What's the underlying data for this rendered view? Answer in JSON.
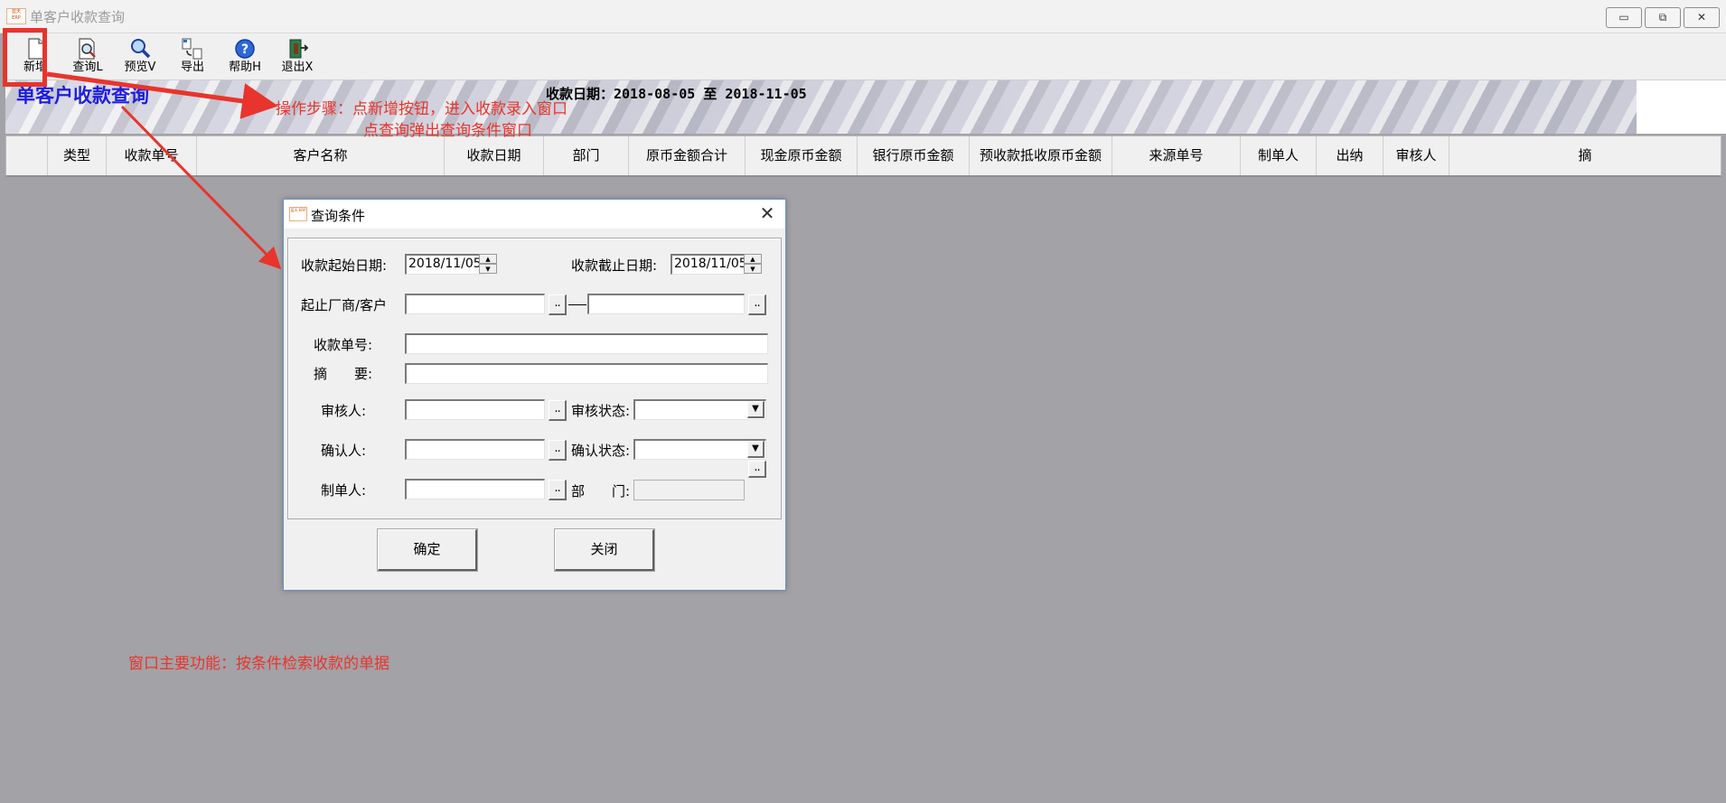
{
  "window": {
    "title": "单客户收款查询",
    "icon_text": "蓝天 ERP",
    "controls": [
      "minimize",
      "restore",
      "close"
    ]
  },
  "toolbar": {
    "items": [
      {
        "label": "新增",
        "icon": "new-document-icon"
      },
      {
        "label": "查询L",
        "icon": "query-icon"
      },
      {
        "label": "预览V",
        "icon": "preview-icon"
      },
      {
        "label": "导出",
        "icon": "export-icon"
      },
      {
        "label": "帮助H",
        "icon": "help-icon"
      },
      {
        "label": "退出X",
        "icon": "exit-icon"
      }
    ]
  },
  "banner": {
    "title": "单客户收款查询",
    "date_range": "收款日期：2018-08-05 至 2018-11-05"
  },
  "grid": {
    "columns": [
      "类型",
      "收款单号",
      "客户名称",
      "收款日期",
      "部门",
      "原币金额合计",
      "现金原币金额",
      "银行原币金额",
      "预收款抵收原币金额",
      "来源单号",
      "制单人",
      "出纳",
      "审核人",
      "摘"
    ]
  },
  "dialog": {
    "title": "查询条件",
    "fields": {
      "start_date_label": "收款起始日期:",
      "start_date_value": "2018/11/05",
      "end_date_label": "收款截止日期:",
      "end_date_value": "2018/11/05",
      "customer_range_label": "起止厂商/客户",
      "receipt_no_label": "收款单号:",
      "summary_label": "摘　　要:",
      "reviewer_label": "审核人:",
      "review_status_label": "审核状态:",
      "confirmer_label": "确认人:",
      "confirm_status_label": "确认状态:",
      "creator_label": "制单人:",
      "dept_label": "部　　门:"
    },
    "ok_label": "确定",
    "close_label": "关闭"
  },
  "annotations": {
    "step1": "操作步骤：点新增按钮，进入收款录入窗口",
    "step2": "点查询弹出查询条件窗口",
    "main_function": "窗口主要功能：按条件检索收款的单据",
    "color": "#e8342c"
  }
}
